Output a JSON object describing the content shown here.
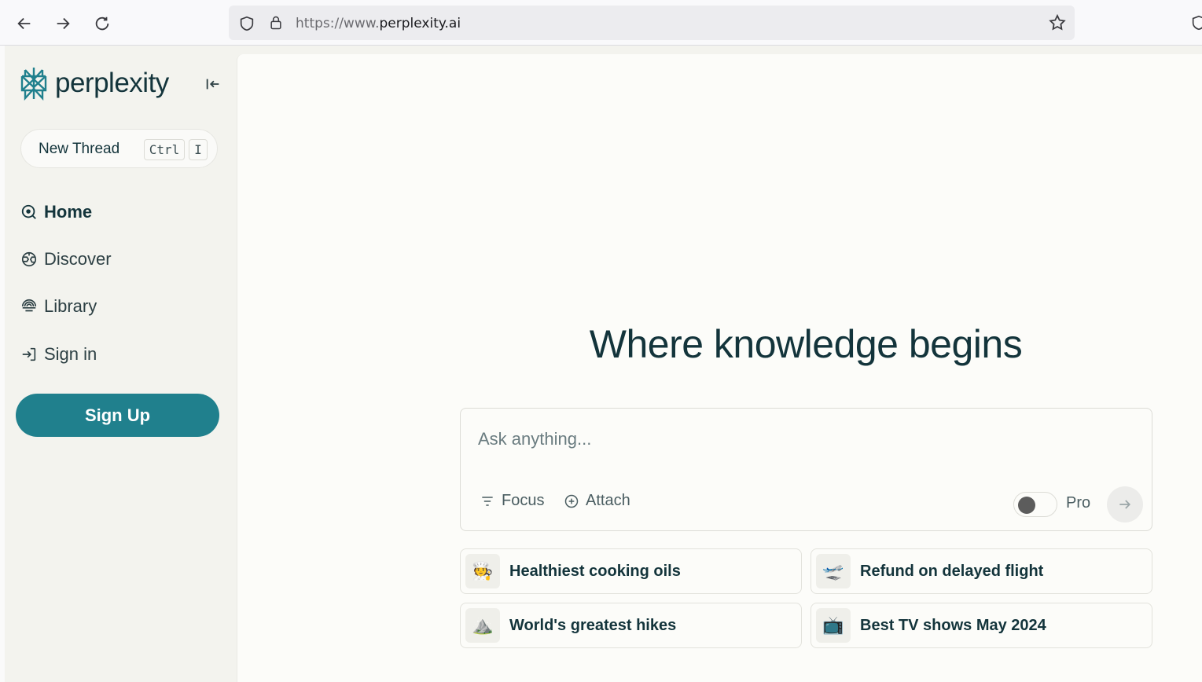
{
  "browser": {
    "url_prefix": "https://www.",
    "url_domain": "perplexity.ai",
    "icons": [
      "back-arrow",
      "forward-arrow",
      "reload",
      "shield",
      "lock",
      "star"
    ]
  },
  "sidebar": {
    "logo_text": "perplexity",
    "new_thread": {
      "label": "New Thread",
      "shortcut_key1": "Ctrl",
      "shortcut_key2": "I"
    },
    "items": [
      {
        "label": "Home",
        "icon": "search-circle-icon",
        "active": true
      },
      {
        "label": "Discover",
        "icon": "globe-icon",
        "active": false
      },
      {
        "label": "Library",
        "icon": "library-icon",
        "active": false
      },
      {
        "label": "Sign in",
        "icon": "sign-in-icon",
        "active": false
      }
    ],
    "signup_label": "Sign Up"
  },
  "main": {
    "headline": "Where knowledge begins",
    "ask": {
      "placeholder": "Ask anything...",
      "focus_label": "Focus",
      "attach_label": "Attach",
      "pro_label": "Pro"
    },
    "suggestions": [
      {
        "emoji": "🧑‍🍳",
        "label": "Healthiest cooking oils"
      },
      {
        "emoji": "🛫",
        "label": "Refund on delayed flight"
      },
      {
        "emoji": "⛰️",
        "label": "World's greatest hikes"
      },
      {
        "emoji": "📺",
        "label": "Best TV shows May 2024"
      }
    ]
  },
  "colors": {
    "accent": "#20808d",
    "text": "#13343b",
    "sidebar_bg": "#f3f3ee",
    "main_bg": "#fcfcf9"
  }
}
